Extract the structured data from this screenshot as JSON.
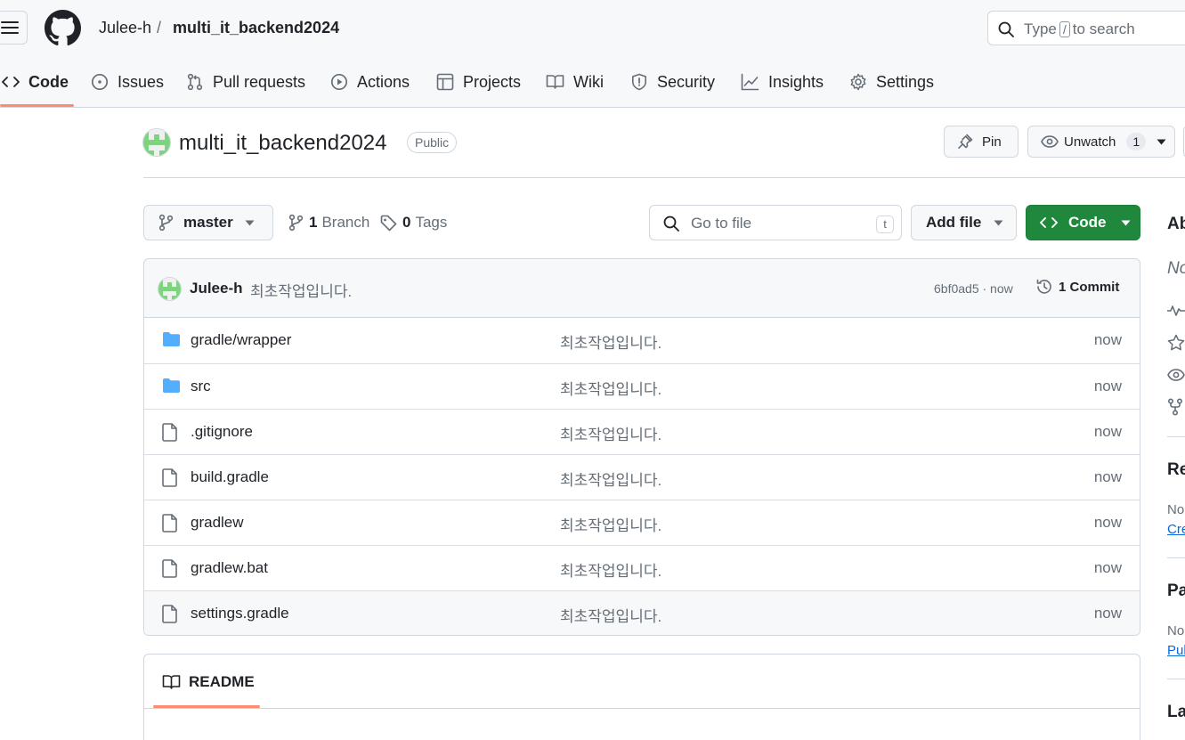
{
  "header": {
    "owner": "Julee-h",
    "separator": "/",
    "repo": "multi_it_backend2024",
    "search_prefix": "Type",
    "search_key": "/",
    "search_suffix": "to search"
  },
  "tabs": [
    {
      "label": "Code",
      "icon": "code-icon",
      "active": true
    },
    {
      "label": "Issues",
      "icon": "issue-opened-icon"
    },
    {
      "label": "Pull requests",
      "icon": "git-pull-request-icon"
    },
    {
      "label": "Actions",
      "icon": "play-icon"
    },
    {
      "label": "Projects",
      "icon": "table-icon"
    },
    {
      "label": "Wiki",
      "icon": "book-icon"
    },
    {
      "label": "Security",
      "icon": "shield-icon"
    },
    {
      "label": "Insights",
      "icon": "graph-icon"
    },
    {
      "label": "Settings",
      "icon": "gear-icon"
    }
  ],
  "repo": {
    "title": "multi_it_backend2024",
    "visibility": "Public",
    "pin_label": "Pin",
    "watch_label": "Unwatch",
    "watch_count": "1"
  },
  "toolbar": {
    "branch": "master",
    "branch_count": "1",
    "branch_label": "Branch",
    "tag_count": "0",
    "tag_label": "Tags",
    "goto_placeholder": "Go to file",
    "goto_key": "t",
    "add_file": "Add file",
    "code": "Code"
  },
  "latest_commit": {
    "author": "Julee-h",
    "message": "최초작업입니다.",
    "sha_time": "6bf0ad5 · now",
    "commits": "1 Commit"
  },
  "files": [
    {
      "name": "gradle/wrapper",
      "type": "folder",
      "message": "최초작업입니다.",
      "age": "now"
    },
    {
      "name": "src",
      "type": "folder",
      "message": "최초작업입니다.",
      "age": "now"
    },
    {
      "name": ".gitignore",
      "type": "file",
      "message": "최초작업입니다.",
      "age": "now"
    },
    {
      "name": "build.gradle",
      "type": "file",
      "message": "최초작업입니다.",
      "age": "now"
    },
    {
      "name": "gradlew",
      "type": "file",
      "message": "최초작업입니다.",
      "age": "now"
    },
    {
      "name": "gradlew.bat",
      "type": "file",
      "message": "최초작업입니다.",
      "age": "now"
    },
    {
      "name": "settings.gradle",
      "type": "file",
      "message": "최초작업입니다.",
      "age": "now"
    }
  ],
  "readme": {
    "tab": "README"
  },
  "sidebar": {
    "about": "Ab",
    "about_desc": "No",
    "releases": "Re",
    "releases_text": "No",
    "releases_link": "Cre",
    "packages": "Pa",
    "packages_text": "No",
    "packages_link": "Pub",
    "languages": "La"
  },
  "colors": {
    "accent_green": "#1f883d",
    "folder_blue": "#54aeff",
    "tab_underline": "#fd8c73",
    "link_blue": "#0969da"
  }
}
